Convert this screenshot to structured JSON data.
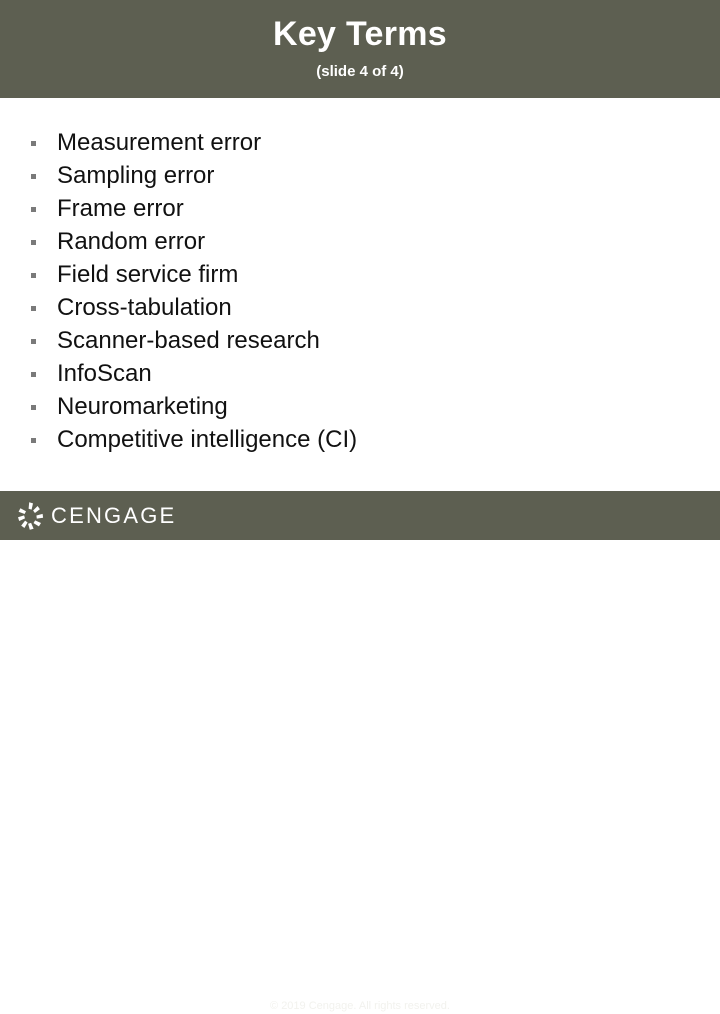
{
  "header": {
    "title": "Key Terms",
    "subtitle": "(slide 4 of 4)",
    "background_color": "#5d5f51",
    "text_color": "#ffffff"
  },
  "body": {
    "bullet_glyph": "square-bullet",
    "text_color": "#111111",
    "items": [
      {
        "label": "Measurement error"
      },
      {
        "label": "Sampling error"
      },
      {
        "label": "Frame error"
      },
      {
        "label": "Random error"
      },
      {
        "label": "Field service firm"
      },
      {
        "label": "Cross-tabulation"
      },
      {
        "label": "Scanner-based research"
      },
      {
        "label": "InfoScan"
      },
      {
        "label": "Neuromarketing"
      },
      {
        "label": "Competitive intelligence (CI)"
      }
    ]
  },
  "footer": {
    "logo_icon": "cengage-pinwheel-logo-icon",
    "wordmark": "CENGAGE",
    "copyright": "© 2019 Cengage. All rights reserved.",
    "background_color": "#5d5f51",
    "text_color": "#ffffff"
  }
}
